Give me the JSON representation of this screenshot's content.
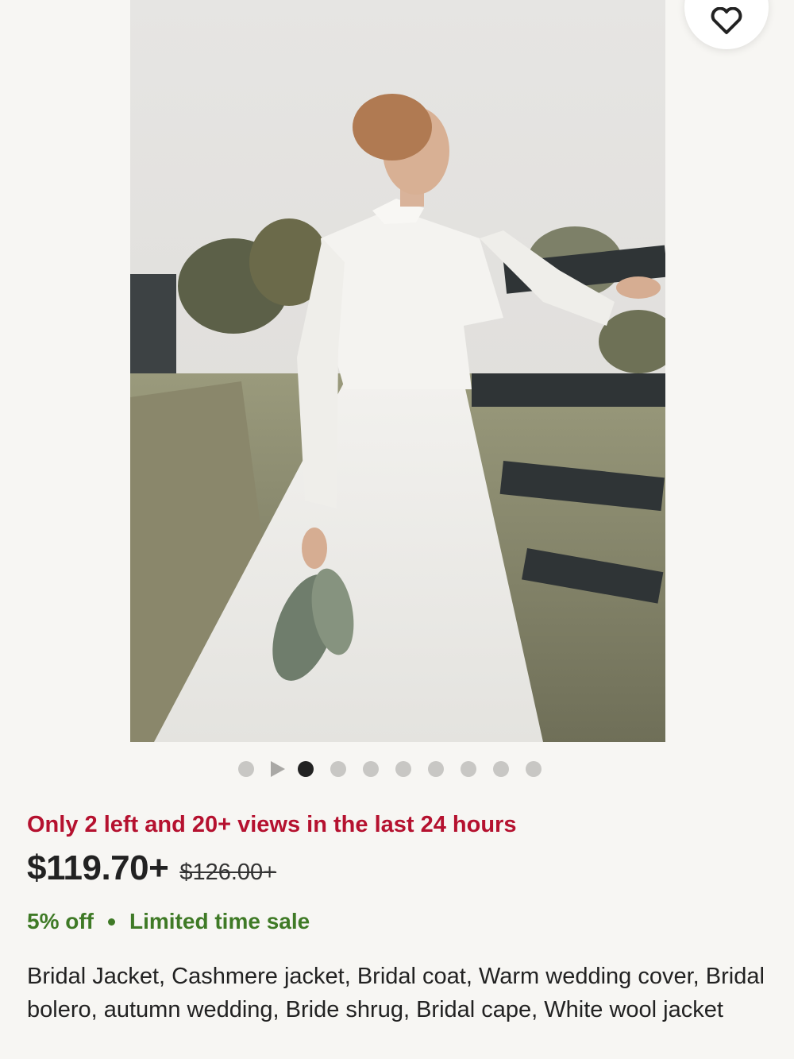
{
  "actions": {
    "share_icon": "share-icon",
    "favorite_icon": "heart-icon"
  },
  "listing": {
    "image_alt": "Bride in white jacket and tulle skirt beside a fence",
    "carousel": {
      "total_dots": 9,
      "active_index": 1,
      "has_video": true
    },
    "scarcity": "Only 2 left and 20+ views in the last 24 hours",
    "price": "$119.70+",
    "original_price": "$126.00+",
    "discount": "5% off",
    "sale_label": "Limited time sale",
    "title": "Bridal Jacket, Cashmere jacket, Bridal coat, Warm wedding cover, Bridal bolero, autumn wedding, Bride shrug, Bridal cape, White wool jacket"
  },
  "colors": {
    "background": "#f7f6f3",
    "scarcity": "#b5112f",
    "sale": "#3f7a26",
    "text": "#222222"
  }
}
